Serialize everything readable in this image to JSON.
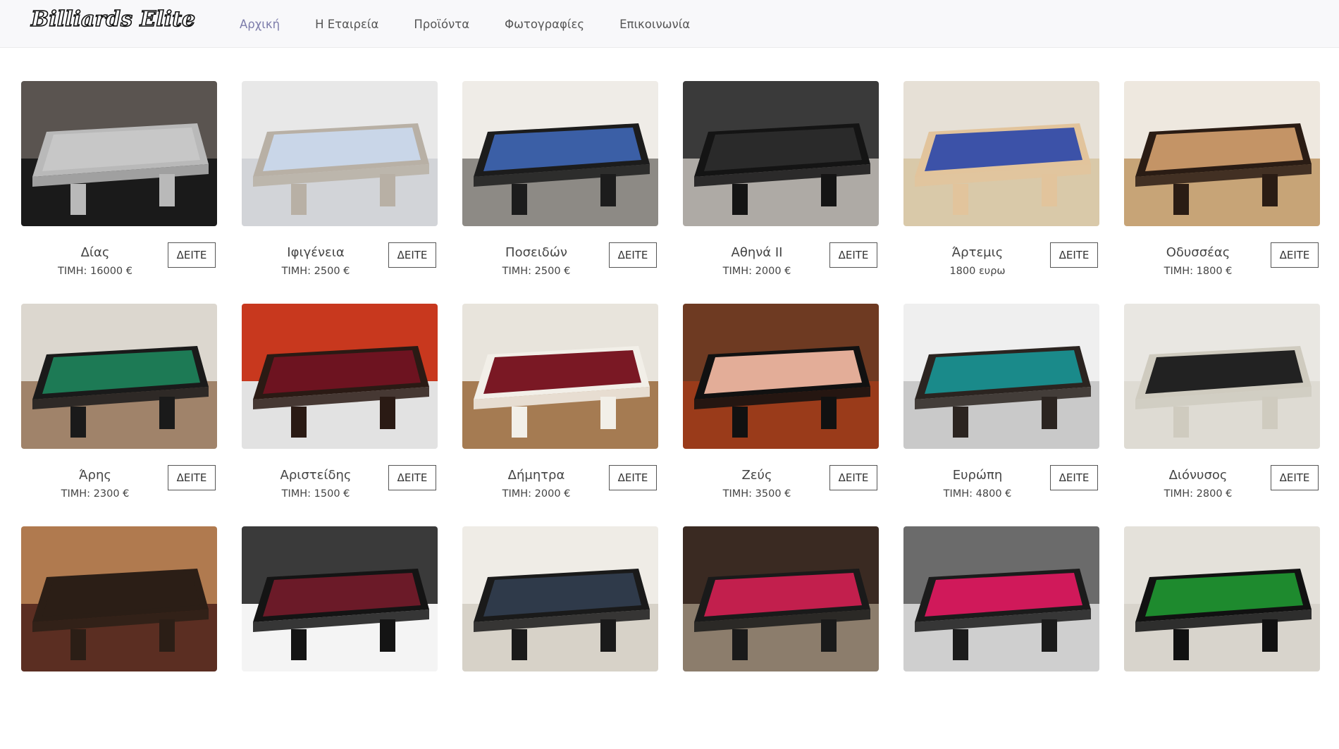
{
  "header": {
    "logo_text": "Billiards Elite",
    "nav": [
      {
        "label": "Αρχική",
        "active": true
      },
      {
        "label": "Η Εταιρεία"
      },
      {
        "label": "Προϊόντα"
      },
      {
        "label": "Φωτογραφίες"
      },
      {
        "label": "Επικοινωνία"
      }
    ]
  },
  "products": [
    {
      "name": "Δίας",
      "price": "ΤΙΜΗ: 16000 €",
      "button": "ΔΕΙΤΕ",
      "felt": "#c7c7c7",
      "frame": "#b9b9b9",
      "bg": "#5a5450",
      "floor": "#1a1a1a"
    },
    {
      "name": "Ιφιγένεια",
      "price": "ΤΙΜΗ: 2500 €",
      "button": "ΔΕΙΤΕ",
      "felt": "#c9d6e8",
      "frame": "#b8b0a5",
      "bg": "#e8e8e8",
      "floor": "#d2d4d8"
    },
    {
      "name": "Ποσειδών",
      "price": "ΤΙΜΗ: 2500 €",
      "button": "ΔΕΙΤΕ",
      "felt": "#3b5fa6",
      "frame": "#1c1c1c",
      "bg": "#efece7",
      "floor": "#8d8a85"
    },
    {
      "name": "Αθηνά ΙΙ",
      "price": "ΤΙΜΗ: 2000 €",
      "button": "ΔΕΙΤΕ",
      "felt": "#2a2a2a",
      "frame": "#141414",
      "bg": "#3a3a3a",
      "floor": "#aeaaa5"
    },
    {
      "name": "Άρτεμις",
      "price": "1800 ευρω",
      "button": "ΔΕΙΤΕ",
      "felt": "#3c52a8",
      "frame": "#e2c49c",
      "bg": "#e6e0d6",
      "floor": "#d9c9a9"
    },
    {
      "name": "Οδυσσέας",
      "price": "ΤΙΜΗ: 1800 €",
      "button": "ΔΕΙΤΕ",
      "felt": "#c49466",
      "frame": "#2a1c14",
      "bg": "#eee8df",
      "floor": "#c7a477"
    },
    {
      "name": "Άρης",
      "price": "ΤΙΜΗ: 2300 €",
      "button": "ΔΕΙΤΕ",
      "felt": "#1d7a55",
      "frame": "#1a1a1a",
      "bg": "#dcd7cf",
      "floor": "#a0836a"
    },
    {
      "name": "Αριστείδης",
      "price": "ΤΙΜΗ: 1500 €",
      "button": "ΔΕΙΤΕ",
      "felt": "#6d1320",
      "frame": "#2a1a14",
      "bg": "#c8381e",
      "floor": "#e2e2e2"
    },
    {
      "name": "Δήμητρα",
      "price": "ΤΙΜΗ: 2000 €",
      "button": "ΔΕΙΤΕ",
      "felt": "#7a1824",
      "frame": "#f2efe8",
      "bg": "#e8e4dc",
      "floor": "#a57b52"
    },
    {
      "name": "Ζεύς",
      "price": "ΤΙΜΗ: 3500 €",
      "button": "ΔΕΙΤΕ",
      "felt": "#e3ad98",
      "frame": "#111111",
      "bg": "#6e3a22",
      "floor": "#9a3b1a"
    },
    {
      "name": "Ευρώπη",
      "price": "ΤΙΜΗ: 4800 €",
      "button": "ΔΕΙΤΕ",
      "felt": "#1a8a8a",
      "frame": "#2b2420",
      "bg": "#efefef",
      "floor": "#c9c9c9"
    },
    {
      "name": "Διόνυσος",
      "price": "ΤΙΜΗ: 2800 €",
      "button": "ΔΕΙΤΕ",
      "felt": "#222222",
      "frame": "#cfcbbf",
      "bg": "#e9e7e2",
      "floor": "#dedbd3"
    },
    {
      "name": "",
      "price": "",
      "button": "",
      "felt": "#2b1e16",
      "frame": "#2b1e16",
      "bg": "#b07a4f",
      "floor": "#5b2e22"
    },
    {
      "name": "",
      "price": "",
      "button": "",
      "felt": "#6b1a28",
      "frame": "#141414",
      "bg": "#3a3a3a",
      "floor": "#f4f4f4"
    },
    {
      "name": "",
      "price": "",
      "button": "",
      "felt": "#2f3a4a",
      "frame": "#1a1a1a",
      "bg": "#efece6",
      "floor": "#d7d2c8"
    },
    {
      "name": "",
      "price": "",
      "button": "",
      "felt": "#c21f4d",
      "frame": "#1a1a1a",
      "bg": "#3a2a22",
      "floor": "#8c7d6c"
    },
    {
      "name": "",
      "price": "",
      "button": "",
      "felt": "#d0195a",
      "frame": "#1b1b1b",
      "bg": "#6b6b6b",
      "floor": "#cfcfcf"
    },
    {
      "name": "",
      "price": "",
      "button": "",
      "felt": "#1e8a2e",
      "frame": "#111111",
      "bg": "#e4e1da",
      "floor": "#d8d4cc"
    }
  ]
}
